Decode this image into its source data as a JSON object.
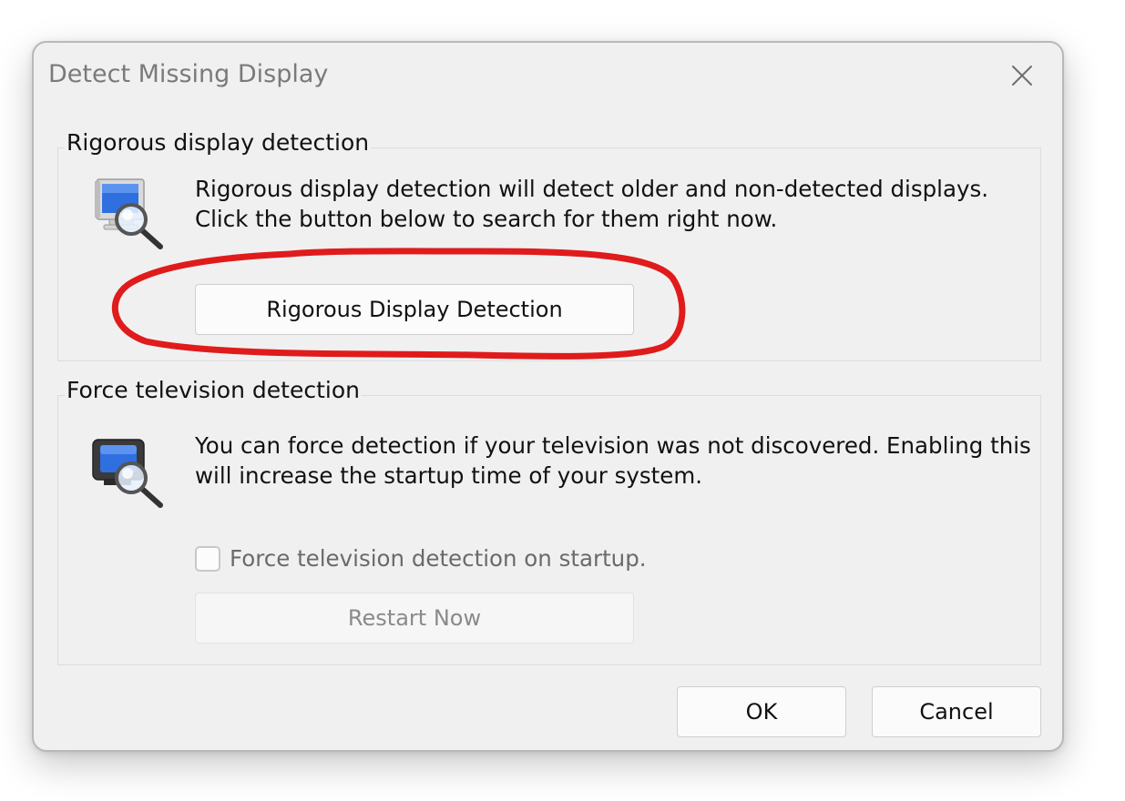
{
  "dialog": {
    "title": "Detect Missing Display",
    "close_icon": "close-icon"
  },
  "rigorous_section": {
    "legend": "Rigorous display detection",
    "icon": "monitor-magnifier-icon",
    "description_line1": "Rigorous display detection will detect older and non-detected displays.",
    "description_line2": "Click the button below to search for them right now.",
    "button_label": "Rigorous Display Detection"
  },
  "tv_section": {
    "legend": "Force television detection",
    "icon": "television-magnifier-icon",
    "description_line1": "You can force detection if your television was not discovered.  Enabling this",
    "description_line2": "will increase the startup time of your system.",
    "checkbox_label": "Force television detection on startup.",
    "checkbox_checked": false,
    "checkbox_enabled": false,
    "restart_label": "Restart Now",
    "restart_enabled": false
  },
  "footer": {
    "ok_label": "OK",
    "cancel_label": "Cancel"
  },
  "annotation": {
    "color": "#e01b1b",
    "shape": "hand-drawn ellipse around Rigorous Display Detection button"
  }
}
